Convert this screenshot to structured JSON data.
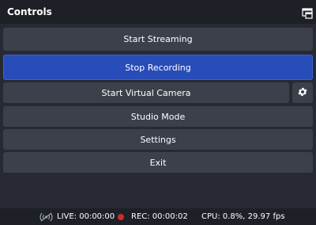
{
  "dock": {
    "title": "Controls",
    "undock_icon": "undock-icon"
  },
  "buttons": {
    "start_streaming": "Start Streaming",
    "stop_recording": "Stop Recording",
    "start_virtual_camera": "Start Virtual Camera",
    "studio_mode": "Studio Mode",
    "settings": "Settings",
    "exit": "Exit"
  },
  "virtual_camera_settings_icon": "gear-icon",
  "status": {
    "live": "LIVE: 00:00:00",
    "rec": "REC: 00:00:02",
    "cpu": "CPU: 0.8%, 29.97 fps"
  },
  "colors": {
    "active_button": "#284cb8",
    "button": "#3c404b",
    "rec_indicator": "#d22a2a"
  }
}
